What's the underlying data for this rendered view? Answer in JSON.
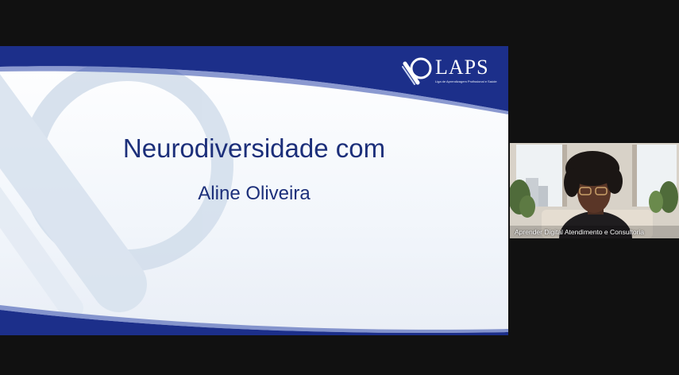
{
  "slide": {
    "logo_text": "LAPS",
    "logo_subtitle": "Liga de Aprendizagem Profissional e Saúde",
    "title": "Neurodiversidade com",
    "subtitle": "Aline Oliveira"
  },
  "participant": {
    "name": "Aprender Digital Atendimento e Consultoria"
  },
  "colors": {
    "brand_blue": "#1c2f8a",
    "title_text": "#1c2f7a",
    "background": "#111111"
  }
}
